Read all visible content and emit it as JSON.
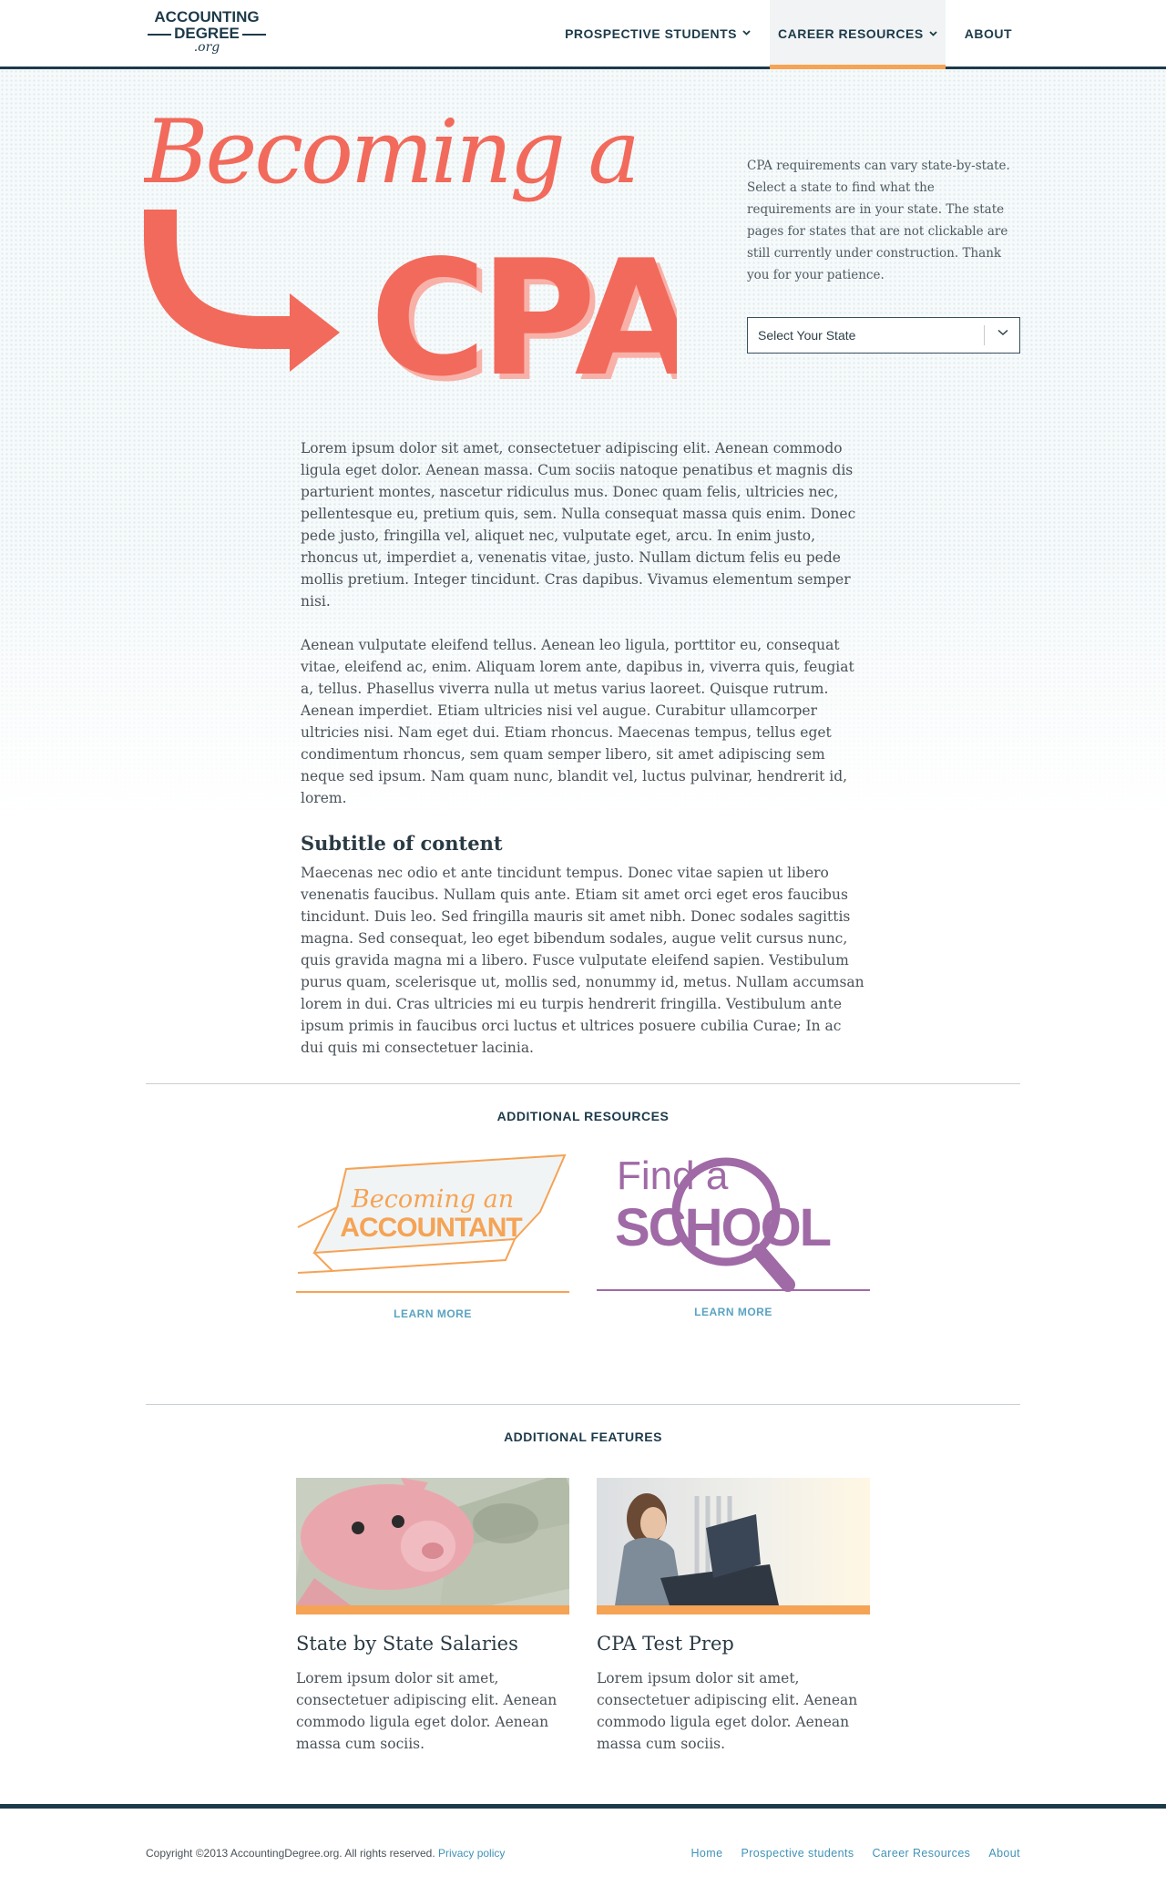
{
  "header": {
    "logo": {
      "line1": "ACCOUNTING",
      "line2": "DEGREE",
      "line3": ".org"
    },
    "nav": [
      {
        "label": "PROSPECTIVE STUDENTS",
        "has_dropdown": true,
        "active": false
      },
      {
        "label": "CAREER RESOURCES",
        "has_dropdown": true,
        "active": true
      },
      {
        "label": "ABOUT",
        "has_dropdown": false,
        "active": false
      }
    ]
  },
  "hero": {
    "title_line1": "Becoming a",
    "title_line2": "CPA",
    "description": "CPA requirements can vary state-by-state. Select a state to find what the requirements are in your state. The state pages for states that are not clickable are still currently under construction. Thank you for your patience.",
    "select": {
      "value": "Select Your State",
      "icon": "chevron-down-icon"
    }
  },
  "content": {
    "p1": "Lorem ipsum dolor sit amet, consectetuer adipiscing elit. Aenean commodo ligula eget dolor. Aenean massa. Cum sociis natoque penatibus et magnis dis parturient montes, nascetur ridiculus mus. Donec quam felis, ultricies nec, pellentesque eu, pretium quis, sem. Nulla consequat massa quis enim. Donec pede justo, fringilla vel, aliquet nec, vulputate eget, arcu. In enim justo, rhoncus ut, imperdiet a, venenatis vitae, justo. Nullam dictum felis eu pede mollis pretium. Integer tincidunt. Cras dapibus. Vivamus elementum semper nisi.",
    "p2": "Aenean vulputate eleifend tellus. Aenean leo ligula, porttitor eu, consequat vitae, eleifend ac, enim. Aliquam lorem ante, dapibus in, viverra quis, feugiat a, tellus. Phasellus viverra nulla ut metus varius laoreet. Quisque rutrum. Aenean imperdiet. Etiam ultricies nisi vel augue. Curabitur ullamcorper ultricies nisi. Nam eget dui. Etiam rhoncus. Maecenas tempus, tellus eget condimentum rhoncus, sem quam semper libero, sit amet adipiscing sem neque sed ipsum. Nam quam nunc, blandit vel, luctus pulvinar, hendrerit id, lorem.",
    "subtitle": "Subtitle of content",
    "p3": "Maecenas nec odio et ante tincidunt tempus. Donec vitae sapien ut libero venenatis faucibus. Nullam quis ante. Etiam sit amet orci eget eros faucibus tincidunt. Duis leo. Sed fringilla mauris sit amet nibh. Donec sodales sagittis magna. Sed consequat, leo eget bibendum sodales, augue velit cursus nunc, quis gravida magna mi a libero. Fusce vulputate eleifend sapien. Vestibulum purus quam, scelerisque ut, mollis sed, nonummy id, metus. Nullam accumsan lorem in dui. Cras ultricies mi eu turpis hendrerit fringilla. Vestibulum ante ipsum primis in faucibus orci luctus et ultrices posuere cubilia Curae; In ac dui quis mi consectetuer lacinia."
  },
  "resources": {
    "title": "ADDITIONAL RESOURCES",
    "cards": [
      {
        "line1": "Becoming an",
        "line2": "ACCOUNTANT",
        "link": "LEARN MORE",
        "color": "#f5a355"
      },
      {
        "line1": "Find a",
        "line2": "SCHOOL",
        "link": "LEARN MORE",
        "color": "#a06aa6"
      }
    ]
  },
  "features": {
    "title": "ADDITIONAL FEATURES",
    "cards": [
      {
        "title": "State by State Salaries",
        "text": "Lorem ipsum dolor sit amet, consectetuer adipiscing elit. Aenean commodo ligula eget dolor. Aenean massa cum sociis."
      },
      {
        "title": "CPA Test Prep",
        "text": "Lorem ipsum dolor sit amet, consectetuer adipiscing elit. Aenean commodo ligula eget dolor. Aenean massa cum sociis."
      }
    ]
  },
  "footer": {
    "copyright": "Copyright ©2013 AccountingDegree.org. All rights reserved.",
    "privacy": "Privacy policy",
    "links": [
      "Home",
      "Prospective students",
      "Career Resources",
      "About"
    ]
  },
  "colors": {
    "navy": "#1d3a4a",
    "coral": "#f26a5b",
    "orange": "#f5a355",
    "purple": "#a06aa6",
    "link": "#3f93b8"
  }
}
